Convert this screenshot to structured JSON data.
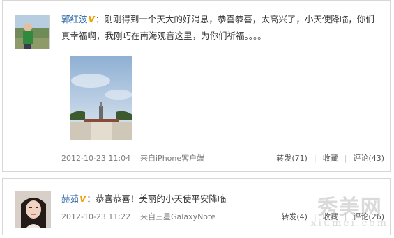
{
  "posts": [
    {
      "author": "郭红波",
      "verified_icon": "v-badge-icon",
      "text": "：刚刚得到一个天大的好消息，恭喜恭喜，太高兴了，小天使降临，你们真幸福啊，我刚巧在南海观音这里，为你们祈福。。。。",
      "timestamp": "2012-10-23 11:04",
      "source": "来自iPhone客户端",
      "actions": {
        "repost": "转发(71)",
        "favorite": "收藏",
        "comment": "评论(43)"
      }
    },
    {
      "author": "赫茹",
      "verified_icon": "v-badge-icon",
      "text": "：恭喜恭喜！美丽的小天使平安降临",
      "timestamp": "2012-10-23 11:22",
      "source": "来自三星GalaxyNote",
      "actions": {
        "repost": "转发(4)",
        "favorite": "收藏",
        "comment": "评论(26)"
      }
    }
  ],
  "separator": "|",
  "watermark": {
    "cn": "秀美网",
    "en": "xiumei.com"
  },
  "colors": {
    "link": "#2a64a5",
    "meta": "#7a7a7a",
    "border": "#d7d7d7",
    "verified": "#f0a000"
  }
}
